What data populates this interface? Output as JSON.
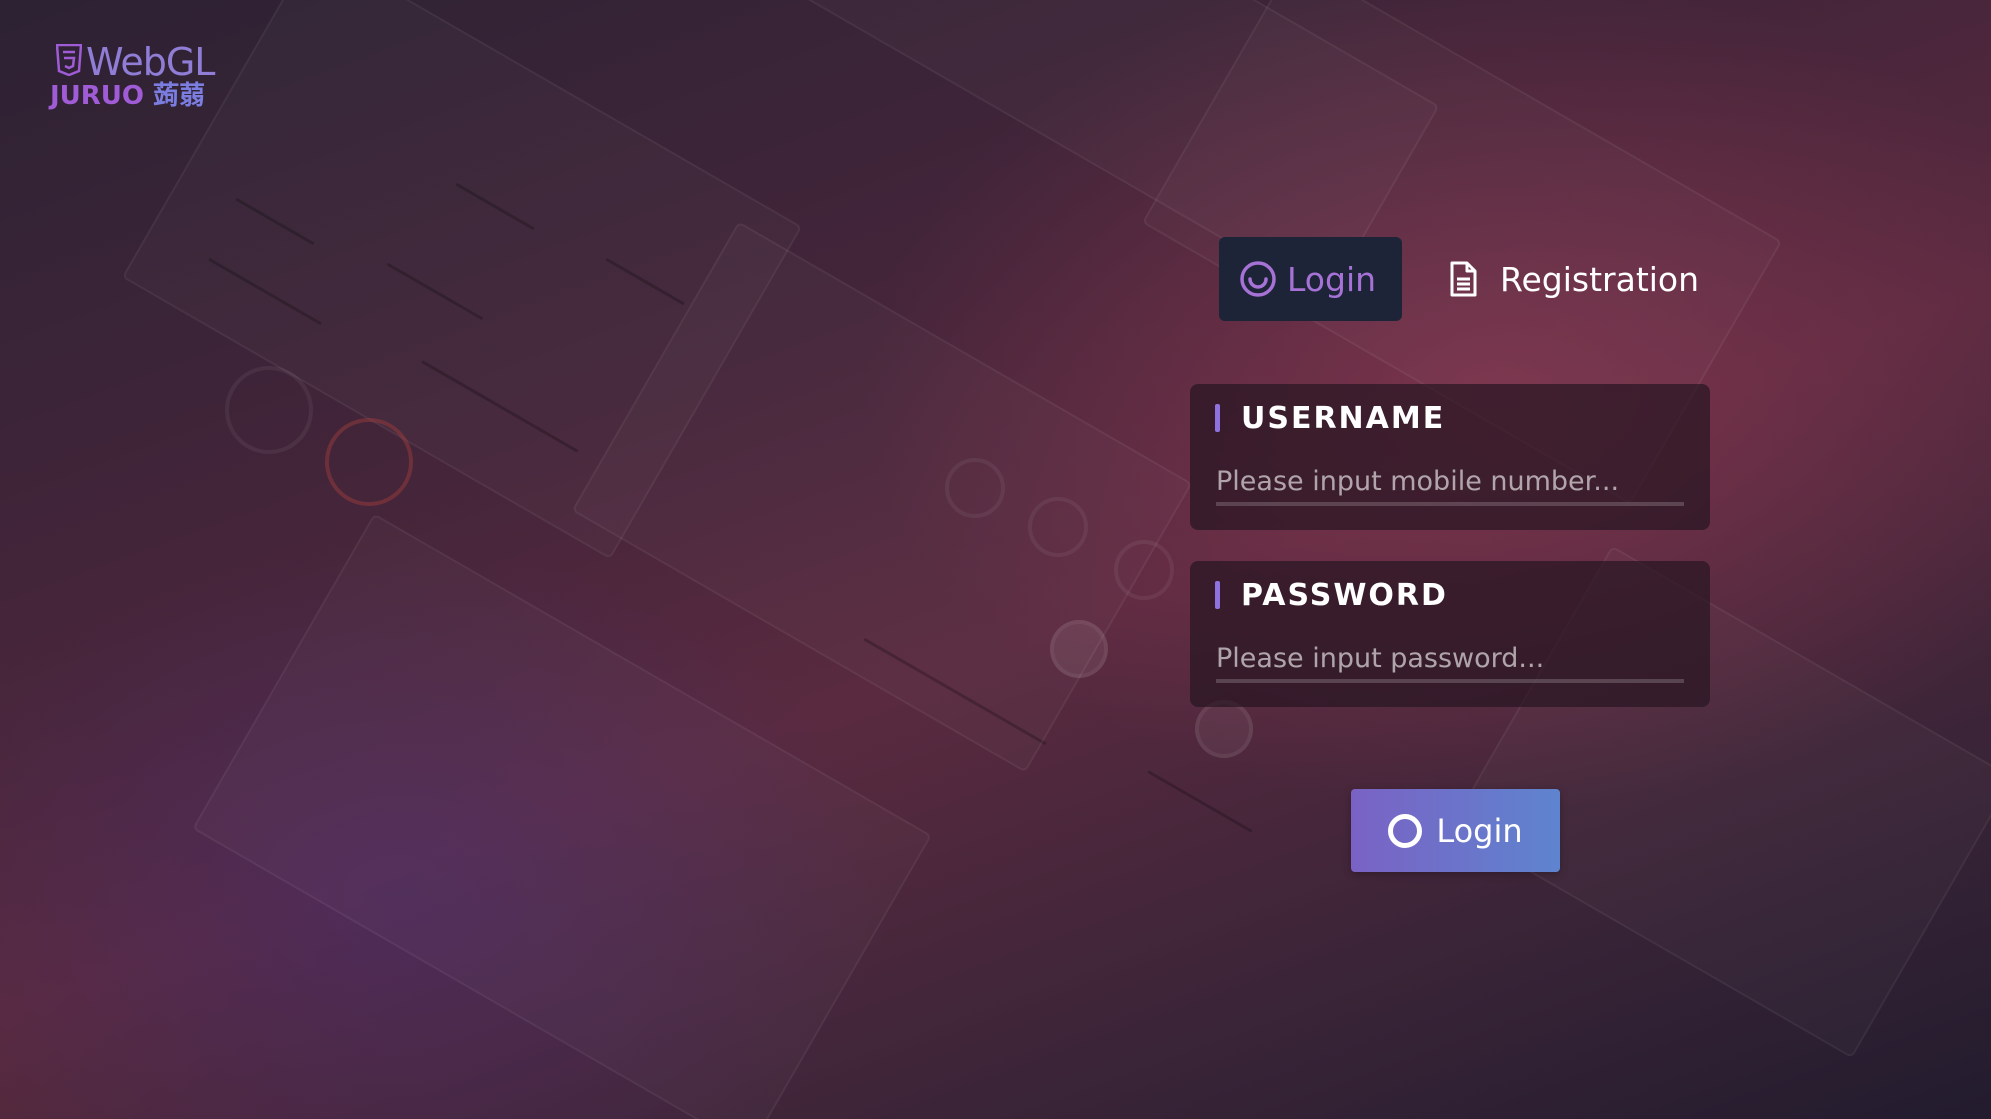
{
  "logo": {
    "brand_top": "WebGL",
    "brand_name": "JURUO",
    "brand_cjk": "蒟蒻",
    "icon": "html5-shield-icon"
  },
  "tabs": [
    {
      "label": "Login",
      "icon": "smile-circle-icon",
      "active": true
    },
    {
      "label": "Registration",
      "icon": "document-icon",
      "active": false
    }
  ],
  "form": {
    "username": {
      "label": "USERNAME",
      "placeholder": "Please input mobile number...",
      "value": ""
    },
    "password": {
      "label": "PASSWORD",
      "placeholder": "Please input password...",
      "value": ""
    },
    "submit": {
      "label": "Login",
      "icon": "ring-icon"
    }
  },
  "colors": {
    "accent_purple": "#a772d6",
    "active_tab_bg": "#1d2438",
    "button_gradient_start": "#7a62c4",
    "button_gradient_end": "#5e84cf",
    "label_bar": "#8d72e0"
  }
}
